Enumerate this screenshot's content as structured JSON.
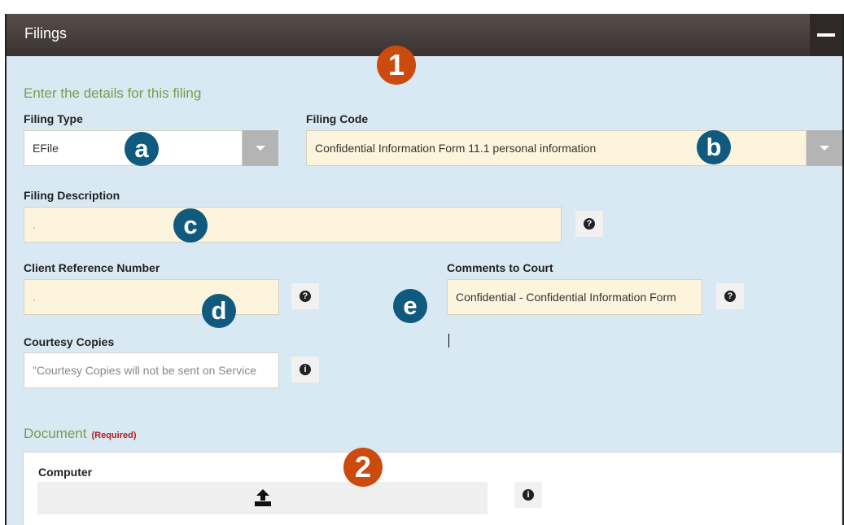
{
  "panel": {
    "title": "Filings",
    "collapse_icon": "minus-icon"
  },
  "details": {
    "heading": "Enter the details for this filing",
    "filing_type": {
      "label": "Filing Type",
      "value": "EFile"
    },
    "filing_code": {
      "label": "Filing Code",
      "value": "Confidential Information Form 11.1 personal information"
    },
    "filing_description": {
      "label": "Filing Description",
      "value": "."
    },
    "client_reference": {
      "label": "Client Reference Number",
      "value": "."
    },
    "comments": {
      "label": "Comments to Court",
      "value": "Confidential - Confidential Information Form"
    },
    "courtesy_copies": {
      "label": "Courtesy Copies",
      "value": "\"Courtesy Copies will not be sent on Service"
    }
  },
  "document": {
    "heading": "Document",
    "required": "(Required)",
    "computer_label": "Computer",
    "upload_icon": "upload-icon"
  },
  "icons": {
    "help": "?",
    "info": "i"
  },
  "annotations": {
    "one": "1",
    "two": "2",
    "a": "a",
    "b": "b",
    "c": "c",
    "d": "d",
    "e": "e"
  },
  "colors": {
    "header": "#3a3230",
    "panel_bg": "#d9e9f3",
    "field_highlight": "#fcf4dd",
    "section_heading": "#7c9a4f",
    "required": "#b11d1d",
    "badge_teal": "#0f5a7e",
    "badge_orange": "#cc4a0e"
  }
}
